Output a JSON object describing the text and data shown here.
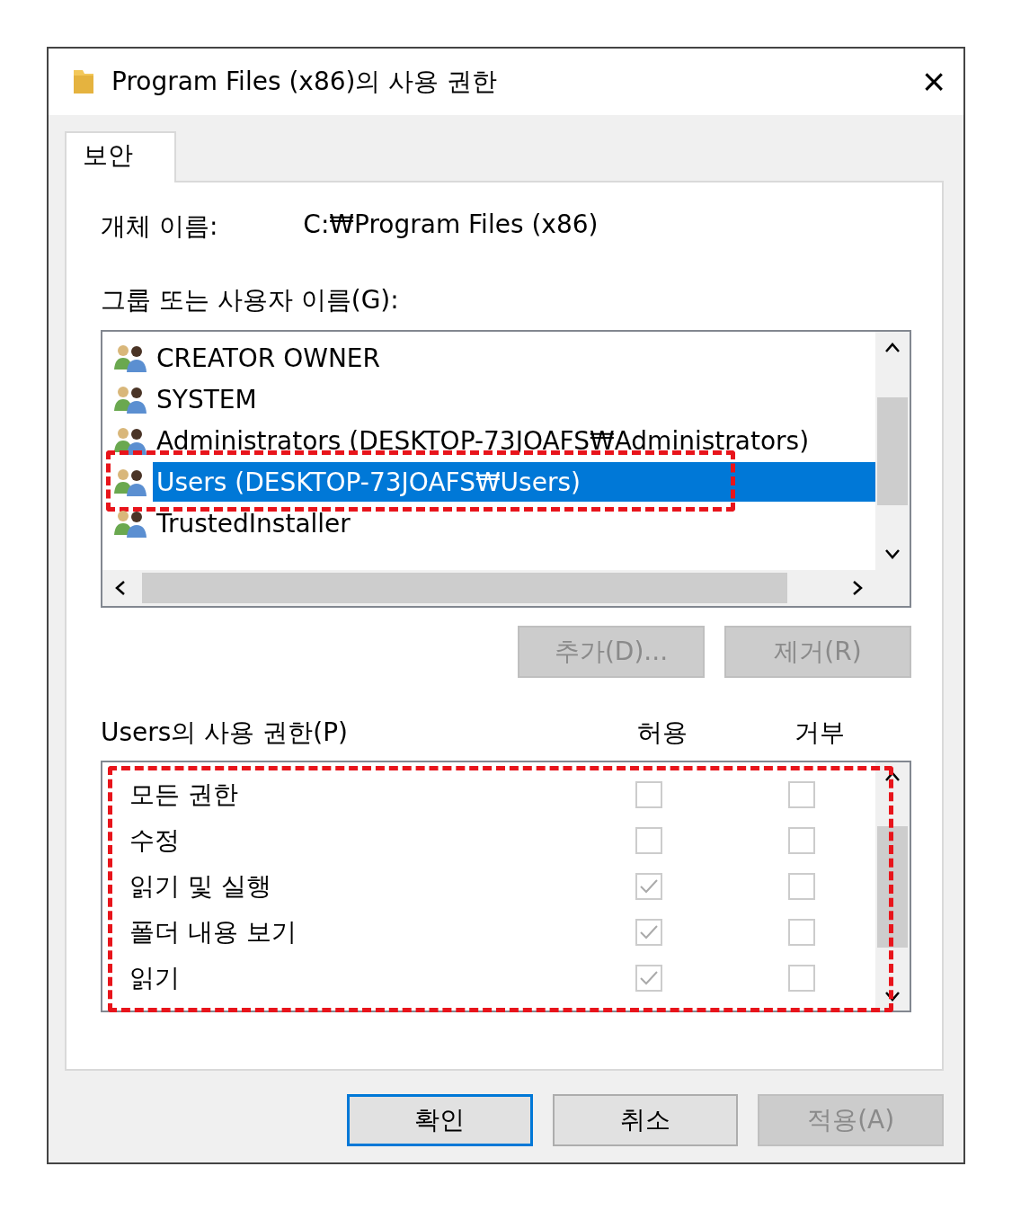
{
  "window": {
    "title": "Program Files (x86)의 사용 권한",
    "close": "×"
  },
  "tabs": [
    {
      "label": "보안",
      "selected": true
    }
  ],
  "object_name": {
    "label": "개체 이름:",
    "value": "C:₩Program Files (x86)"
  },
  "group_list": {
    "label": "그룹 또는 사용자 이름(G):",
    "items": [
      {
        "label": "CREATOR OWNER",
        "selected": false,
        "annotated": false
      },
      {
        "label": "SYSTEM",
        "selected": false,
        "annotated": false
      },
      {
        "label": "Administrators (DESKTOP-73JOAFS₩Administrators)",
        "selected": false,
        "annotated": false
      },
      {
        "label": "Users (DESKTOP-73JOAFS₩Users)",
        "selected": true,
        "annotated": true
      },
      {
        "label": "TrustedInstaller",
        "selected": false,
        "annotated": false
      }
    ]
  },
  "group_buttons": [
    {
      "label": "추가(D)...",
      "disabled": true
    },
    {
      "label": "제거(R)",
      "disabled": true
    }
  ],
  "permissions": {
    "label": "Users의 사용 권한(P)",
    "allow_header": "허용",
    "deny_header": "거부",
    "annotated": true,
    "rows": [
      {
        "label": "모든 권한",
        "allow": false,
        "deny": false
      },
      {
        "label": "수정",
        "allow": false,
        "deny": false
      },
      {
        "label": "읽기 및 실행",
        "allow": true,
        "deny": false
      },
      {
        "label": "폴더 내용 보기",
        "allow": true,
        "deny": false
      },
      {
        "label": "읽기",
        "allow": true,
        "deny": false
      }
    ]
  },
  "buttons": [
    {
      "label": "확인",
      "default": true,
      "disabled": false
    },
    {
      "label": "취소",
      "default": false,
      "disabled": false
    },
    {
      "label": "적용(A)",
      "default": false,
      "disabled": true
    }
  ]
}
